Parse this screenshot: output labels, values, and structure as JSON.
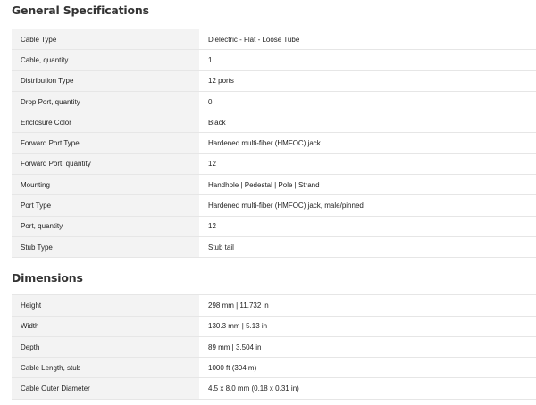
{
  "general": {
    "title": "General Specifications",
    "rows": [
      {
        "label": "Cable Type",
        "value": "Dielectric - Flat - Loose Tube"
      },
      {
        "label": "Cable, quantity",
        "value": "1"
      },
      {
        "label": "Distribution Type",
        "value": "12 ports"
      },
      {
        "label": "Drop Port, quantity",
        "value": "0"
      },
      {
        "label": "Enclosure Color",
        "value": "Black"
      },
      {
        "label": "Forward Port Type",
        "value": "Hardened multi-fiber (HMFOC) jack"
      },
      {
        "label": "Forward Port, quantity",
        "value": "12"
      },
      {
        "label": "Mounting",
        "value": "Handhole | Pedestal | Pole | Strand"
      },
      {
        "label": "Port Type",
        "value": "Hardened multi-fiber (HMFOC) jack, male/pinned"
      },
      {
        "label": "Port, quantity",
        "value": "12"
      },
      {
        "label": "Stub Type",
        "value": "Stub tail"
      }
    ]
  },
  "dimensions": {
    "title": "Dimensions",
    "rows": [
      {
        "label": "Height",
        "value": "298 mm | 11.732 in"
      },
      {
        "label": "Width",
        "value": "130.3 mm | 5.13 in"
      },
      {
        "label": "Depth",
        "value": "89 mm | 3.504 in"
      },
      {
        "label": "Cable Length, stub",
        "value": "1000 ft (304 m)"
      },
      {
        "label": "Cable Outer Diameter",
        "value": "4.5 x 8.0 mm (0.18 x 0.31 in)"
      }
    ]
  }
}
